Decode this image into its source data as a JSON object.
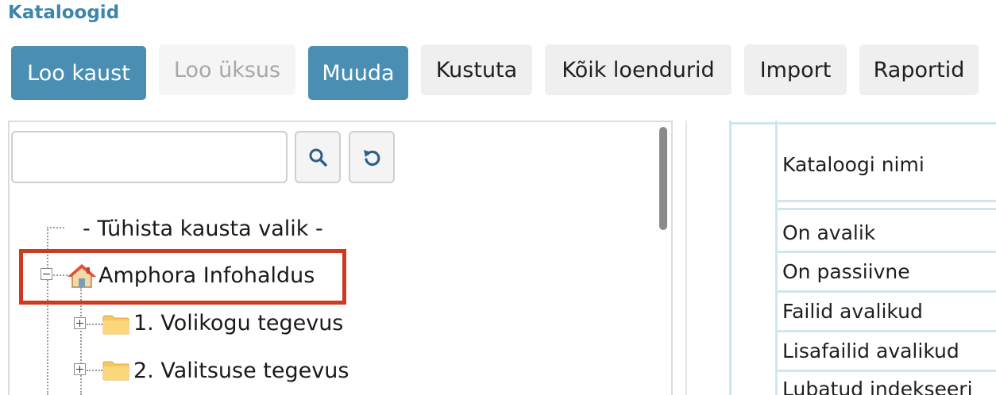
{
  "header": {
    "title": "Kataloogid"
  },
  "toolbar": {
    "buttons": [
      {
        "label": "Loo kaust",
        "state": "primary"
      },
      {
        "label": "Loo üksus",
        "state": "disabled"
      },
      {
        "label": "Muuda",
        "state": "primary"
      },
      {
        "label": "Kustuta",
        "state": "default"
      },
      {
        "label": "Kõik loendurid",
        "state": "default"
      },
      {
        "label": "Import",
        "state": "default"
      },
      {
        "label": "Raportid",
        "state": "default"
      }
    ]
  },
  "tree_pane": {
    "search": {
      "value": "",
      "placeholder": ""
    },
    "search_icon": "magnifier-icon",
    "reset_icon": "refresh-icon",
    "items": [
      {
        "label": "- Tühista kausta valik -"
      },
      {
        "label": "Amphora Infohaldus",
        "icon": "home-icon",
        "expanded": true,
        "highlighted": true
      },
      {
        "label": "1. Volikogu tegevus",
        "icon": "folder-icon",
        "expanded": false
      },
      {
        "label": "2. Valitsuse tegevus",
        "icon": "folder-icon",
        "expanded": false
      }
    ]
  },
  "details_table": {
    "rows": [
      {
        "label": "Kataloogi nimi"
      },
      {
        "label": "On avalik"
      },
      {
        "label": "On passiivne"
      },
      {
        "label": "Failid avalikud"
      },
      {
        "label": "Lisafailid avalikud"
      },
      {
        "label": "Lubatud indekseeri"
      }
    ]
  },
  "colors": {
    "accent": "#4a8fb3",
    "title": "#3d86ab",
    "highlight": "#cc3a22"
  }
}
